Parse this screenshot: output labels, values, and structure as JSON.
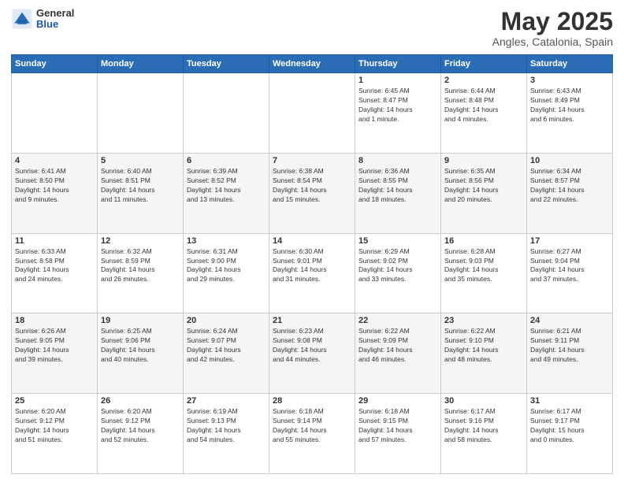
{
  "logo": {
    "general": "General",
    "blue": "Blue"
  },
  "header": {
    "title": "May 2025",
    "subtitle": "Angles, Catalonia, Spain"
  },
  "weekdays": [
    "Sunday",
    "Monday",
    "Tuesday",
    "Wednesday",
    "Thursday",
    "Friday",
    "Saturday"
  ],
  "weeks": [
    [
      {
        "day": "",
        "info": ""
      },
      {
        "day": "",
        "info": ""
      },
      {
        "day": "",
        "info": ""
      },
      {
        "day": "",
        "info": ""
      },
      {
        "day": "1",
        "info": "Sunrise: 6:45 AM\nSunset: 8:47 PM\nDaylight: 14 hours\nand 1 minute."
      },
      {
        "day": "2",
        "info": "Sunrise: 6:44 AM\nSunset: 8:48 PM\nDaylight: 14 hours\nand 4 minutes."
      },
      {
        "day": "3",
        "info": "Sunrise: 6:43 AM\nSunset: 8:49 PM\nDaylight: 14 hours\nand 6 minutes."
      }
    ],
    [
      {
        "day": "4",
        "info": "Sunrise: 6:41 AM\nSunset: 8:50 PM\nDaylight: 14 hours\nand 9 minutes."
      },
      {
        "day": "5",
        "info": "Sunrise: 6:40 AM\nSunset: 8:51 PM\nDaylight: 14 hours\nand 11 minutes."
      },
      {
        "day": "6",
        "info": "Sunrise: 6:39 AM\nSunset: 8:52 PM\nDaylight: 14 hours\nand 13 minutes."
      },
      {
        "day": "7",
        "info": "Sunrise: 6:38 AM\nSunset: 8:54 PM\nDaylight: 14 hours\nand 15 minutes."
      },
      {
        "day": "8",
        "info": "Sunrise: 6:36 AM\nSunset: 8:55 PM\nDaylight: 14 hours\nand 18 minutes."
      },
      {
        "day": "9",
        "info": "Sunrise: 6:35 AM\nSunset: 8:56 PM\nDaylight: 14 hours\nand 20 minutes."
      },
      {
        "day": "10",
        "info": "Sunrise: 6:34 AM\nSunset: 8:57 PM\nDaylight: 14 hours\nand 22 minutes."
      }
    ],
    [
      {
        "day": "11",
        "info": "Sunrise: 6:33 AM\nSunset: 8:58 PM\nDaylight: 14 hours\nand 24 minutes."
      },
      {
        "day": "12",
        "info": "Sunrise: 6:32 AM\nSunset: 8:59 PM\nDaylight: 14 hours\nand 26 minutes."
      },
      {
        "day": "13",
        "info": "Sunrise: 6:31 AM\nSunset: 9:00 PM\nDaylight: 14 hours\nand 29 minutes."
      },
      {
        "day": "14",
        "info": "Sunrise: 6:30 AM\nSunset: 9:01 PM\nDaylight: 14 hours\nand 31 minutes."
      },
      {
        "day": "15",
        "info": "Sunrise: 6:29 AM\nSunset: 9:02 PM\nDaylight: 14 hours\nand 33 minutes."
      },
      {
        "day": "16",
        "info": "Sunrise: 6:28 AM\nSunset: 9:03 PM\nDaylight: 14 hours\nand 35 minutes."
      },
      {
        "day": "17",
        "info": "Sunrise: 6:27 AM\nSunset: 9:04 PM\nDaylight: 14 hours\nand 37 minutes."
      }
    ],
    [
      {
        "day": "18",
        "info": "Sunrise: 6:26 AM\nSunset: 9:05 PM\nDaylight: 14 hours\nand 39 minutes."
      },
      {
        "day": "19",
        "info": "Sunrise: 6:25 AM\nSunset: 9:06 PM\nDaylight: 14 hours\nand 40 minutes."
      },
      {
        "day": "20",
        "info": "Sunrise: 6:24 AM\nSunset: 9:07 PM\nDaylight: 14 hours\nand 42 minutes."
      },
      {
        "day": "21",
        "info": "Sunrise: 6:23 AM\nSunset: 9:08 PM\nDaylight: 14 hours\nand 44 minutes."
      },
      {
        "day": "22",
        "info": "Sunrise: 6:22 AM\nSunset: 9:09 PM\nDaylight: 14 hours\nand 46 minutes."
      },
      {
        "day": "23",
        "info": "Sunrise: 6:22 AM\nSunset: 9:10 PM\nDaylight: 14 hours\nand 48 minutes."
      },
      {
        "day": "24",
        "info": "Sunrise: 6:21 AM\nSunset: 9:11 PM\nDaylight: 14 hours\nand 49 minutes."
      }
    ],
    [
      {
        "day": "25",
        "info": "Sunrise: 6:20 AM\nSunset: 9:12 PM\nDaylight: 14 hours\nand 51 minutes."
      },
      {
        "day": "26",
        "info": "Sunrise: 6:20 AM\nSunset: 9:12 PM\nDaylight: 14 hours\nand 52 minutes."
      },
      {
        "day": "27",
        "info": "Sunrise: 6:19 AM\nSunset: 9:13 PM\nDaylight: 14 hours\nand 54 minutes."
      },
      {
        "day": "28",
        "info": "Sunrise: 6:18 AM\nSunset: 9:14 PM\nDaylight: 14 hours\nand 55 minutes."
      },
      {
        "day": "29",
        "info": "Sunrise: 6:18 AM\nSunset: 9:15 PM\nDaylight: 14 hours\nand 57 minutes."
      },
      {
        "day": "30",
        "info": "Sunrise: 6:17 AM\nSunset: 9:16 PM\nDaylight: 14 hours\nand 58 minutes."
      },
      {
        "day": "31",
        "info": "Sunrise: 6:17 AM\nSunset: 9:17 PM\nDaylight: 15 hours\nand 0 minutes."
      }
    ]
  ]
}
